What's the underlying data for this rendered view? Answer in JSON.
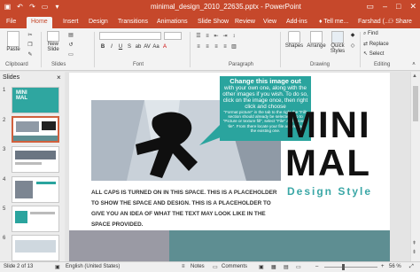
{
  "titlebar": {
    "doc_title": "minimal_design_2010_22635.pptx - PowerPoint",
    "qat_icons": [
      "save-icon",
      "undo-icon",
      "redo-icon",
      "slideshow-icon",
      "customize-icon"
    ]
  },
  "tabs": [
    "File",
    "Home",
    "Insert",
    "Design",
    "Transitions",
    "Animations",
    "Slide Show",
    "Review",
    "View",
    "Add-ins"
  ],
  "active_tab": "Home",
  "tell_me": "Tell me...",
  "user": "Farshad (...",
  "share": "Share",
  "ribbon": {
    "paste": "Paste",
    "new_slide_1": "New",
    "new_slide_2": "Slide",
    "shapes": "Shapes",
    "arrange": "Arrange",
    "quick_styles_1": "Quick",
    "quick_styles_2": "Styles",
    "find": "Find",
    "replace": "Replace",
    "select": "Select",
    "groups": {
      "clipboard": "Clipboard",
      "slides": "Slides",
      "font": "Font",
      "paragraph": "Paragraph",
      "drawing": "Drawing",
      "editing": "Editing"
    },
    "font_format": [
      "B",
      "I",
      "U",
      "S",
      "ab",
      "AV",
      "Aa",
      "A"
    ]
  },
  "slides_pane": {
    "header": "Slides",
    "close": "×",
    "numbers": [
      "1",
      "2",
      "3",
      "4",
      "5",
      "6"
    ],
    "thumb1_text": "MINI MAL"
  },
  "slide": {
    "callout_heading": "Change this image out",
    "callout_body": "with your own one, along with the other images if you wish. To do so, click on the image once, then right click and choose",
    "callout_small": "\"Format picture\" in the tab to the right the \"Fill\" section should already be selected. Go to \"Picture or texture fill\", select \"File\" and choose \"File\". From there locate your file and replace the existing one.",
    "title_line1": "MINI",
    "title_line2": "MAL",
    "subtitle": "Design Style",
    "body_text": "ALL CAPS IS TURNED ON IN THIS SPACE. THIS IS A PLACEHOLDER TO SHOW THE SPACE AND DESIGN. THIS IS A PLACEHOLDER TO GIVE YOU AN IDEA OF WHAT THE TEXT MAY LOOK LIKE IN THE SPACE PROVIDED."
  },
  "statusbar": {
    "slide_of": "Slide 2 of 13",
    "language": "English (United States)",
    "notes": "Notes",
    "comments": "Comments",
    "zoom": "56 %"
  },
  "colors": {
    "accent": "#c6482b",
    "teal": "#2aa49e",
    "teal_text": "#3aa7a6",
    "band_gray": "#9a9aa4",
    "band_teal": "#5e8e92"
  }
}
